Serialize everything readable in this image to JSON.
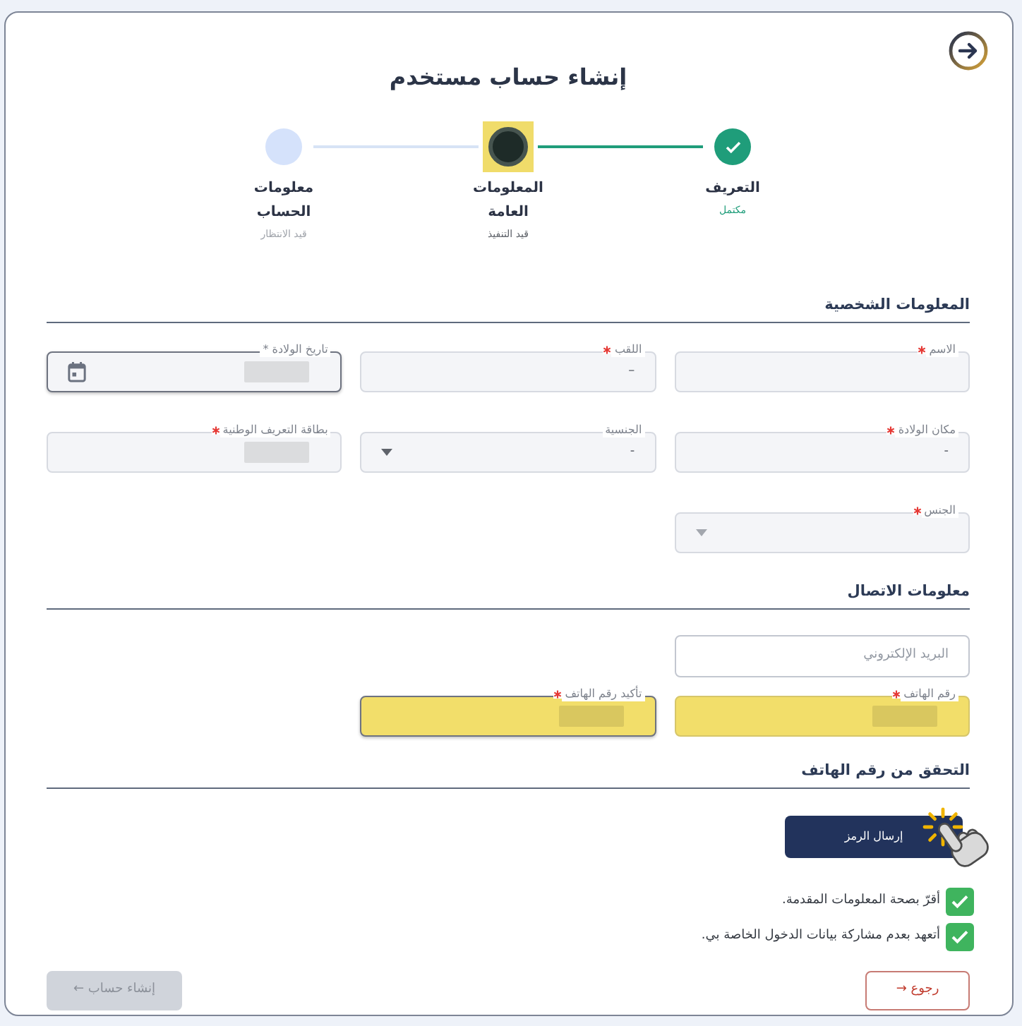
{
  "header": {
    "title": "إنشاء حساب مستخدم"
  },
  "stepper": [
    {
      "label": "التعريف",
      "status": "مكتمل",
      "kind": "completed",
      "highlighted": false
    },
    {
      "label": "المعلومات العامة",
      "status": "قيد التنفيذ",
      "kind": "current",
      "highlighted": true
    },
    {
      "label": "معلومات الحساب",
      "status": "قيد الانتظار",
      "kind": "pending",
      "highlighted": false
    }
  ],
  "personal_info": {
    "heading": "المعلومات الشخصية",
    "rows": [
      [
        {
          "kind": "text",
          "label": "الاسم",
          "required": true,
          "redacted": false,
          "focused": false,
          "highlighted": false
        },
        {
          "kind": "text",
          "label": "اللقب",
          "required": true,
          "value": "–",
          "redacted": false,
          "focused": false,
          "highlighted": false
        },
        {
          "kind": "date",
          "label": "تاريخ الولادة *",
          "required": false,
          "redacted": true,
          "focused": true,
          "highlighted": false
        }
      ],
      [
        {
          "kind": "text",
          "label": "مكان الولادة",
          "required": true,
          "value": "-",
          "redacted": false,
          "focused": false,
          "highlighted": false
        },
        {
          "kind": "select",
          "label": "الجنسية",
          "required": false,
          "value": "-",
          "redacted": false,
          "focused": false,
          "highlighted": false
        },
        {
          "kind": "text",
          "label": "بطاقة التعريف الوطنية",
          "required": true,
          "redacted": true,
          "focused": false,
          "highlighted": false
        }
      ],
      [
        {
          "kind": "select",
          "label": "الجنس",
          "required": true,
          "redacted": false,
          "focused": false,
          "highlighted": false
        }
      ]
    ]
  },
  "contact_info": {
    "heading": "معلومات الاتصال",
    "rows": [
      [
        {
          "kind": "email",
          "placeholder": "البريد الإلكتروني",
          "redacted": false,
          "focused": false,
          "highlighted": false
        }
      ],
      [
        {
          "kind": "text",
          "label": "رقم الهاتف",
          "required": true,
          "redacted": true,
          "focused": false,
          "highlighted": true
        },
        {
          "kind": "text",
          "label": "تأكيد رقم الهاتف",
          "required": true,
          "redacted": true,
          "focused": true,
          "highlighted": true
        }
      ]
    ]
  },
  "phone_verification": {
    "heading": "التحقق من رقم الهاتف",
    "send_button": {
      "label": "إرسال الرمز",
      "pointer_annotation": true
    },
    "agreements": [
      {
        "text": "أقرّ بصحة المعلومات المقدمة.",
        "checked": true
      },
      {
        "text": "أتعهد بعدم مشاركة بيانات الدخول الخاصة بي.",
        "checked": true
      }
    ]
  },
  "actions": {
    "back": {
      "label": "رجوع →",
      "disabled": false
    },
    "create": {
      "label": "إنشاء حساب ←",
      "disabled": true
    }
  }
}
